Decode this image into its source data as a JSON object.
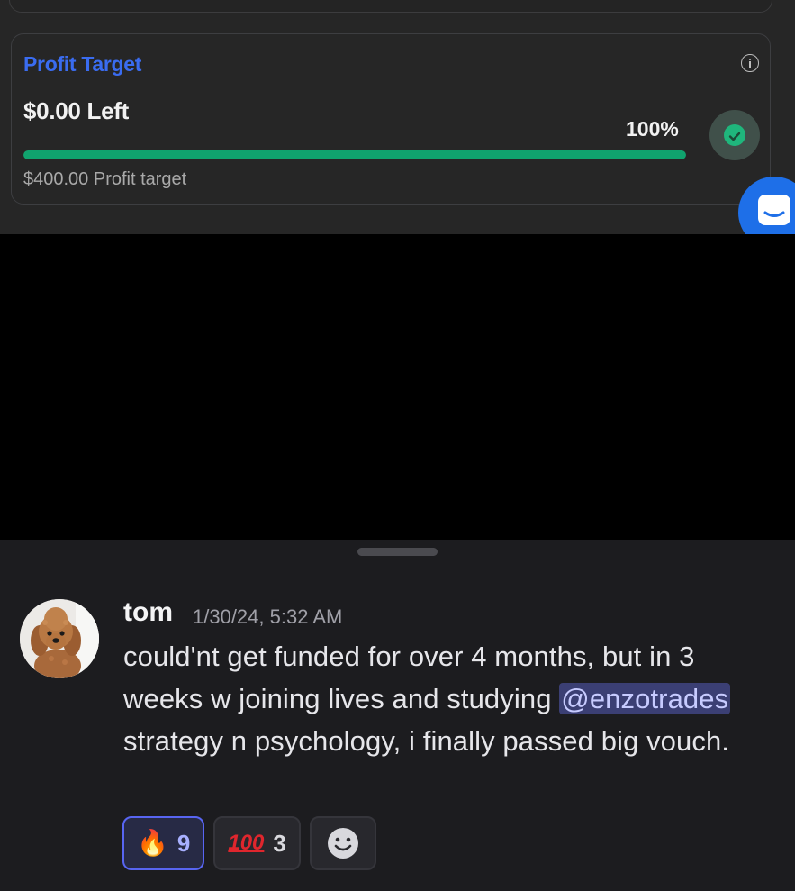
{
  "profit_card": {
    "title": "Profit Target",
    "amount_left": "$0.00 Left",
    "percent_label": "100%",
    "progress_fraction": 1.0,
    "target_label": "$400.00 Profit target",
    "title_color": "#3a6cf0",
    "progress_color": "#10a36e",
    "info_icon": "info-icon",
    "status_icon": "check-circle-icon"
  },
  "support_widget": {
    "icon": "chat-bubble-icon",
    "color": "#1e6fe8"
  },
  "message": {
    "author": "tom",
    "timestamp": "1/30/24, 5:32 AM",
    "text_before_mention": "could'nt get funded for over 4 months, but in 3 weeks w joining lives and studying ",
    "mention": "@enzotrades",
    "text_after_mention": " strategy n psychology, i finally passed big vouch.",
    "avatar": "poodle-avatar"
  },
  "reactions": [
    {
      "emoji": "🔥",
      "count": "9",
      "active": true
    },
    {
      "emoji": "100",
      "count": "3",
      "active": false
    }
  ],
  "add_reaction": {
    "icon": "add-reaction-smiley-icon"
  }
}
